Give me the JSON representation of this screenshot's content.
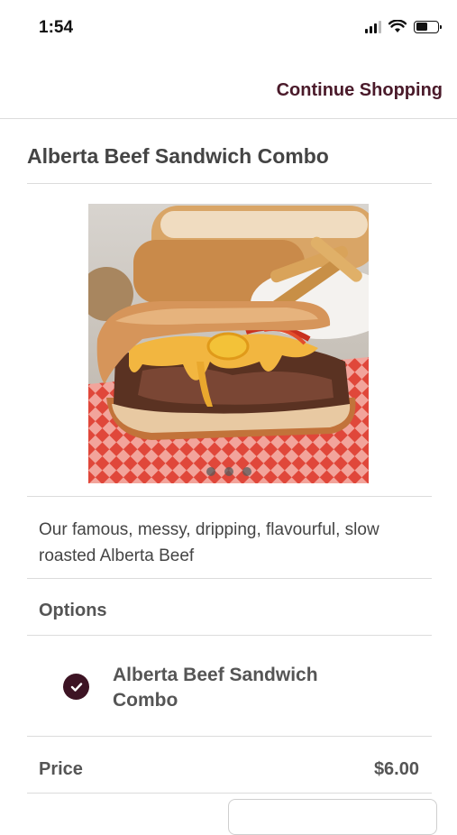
{
  "status_bar": {
    "time": "1:54"
  },
  "nav": {
    "continue_label": "Continue Shopping"
  },
  "product": {
    "title": "Alberta Beef Sandwich Combo",
    "image_alt": "Alberta Beef Sandwich with fries",
    "description": "Our famous, messy, dripping, flavourful, slow roasted Alberta Beef",
    "carousel_count": 3
  },
  "options": {
    "label": "Options",
    "items": [
      {
        "label": "Alberta Beef Sandwich Combo",
        "selected": true
      }
    ]
  },
  "price": {
    "label": "Price",
    "value": "$6.00"
  },
  "colors": {
    "accent": "#4a1a2a",
    "check": "#3d1424"
  }
}
